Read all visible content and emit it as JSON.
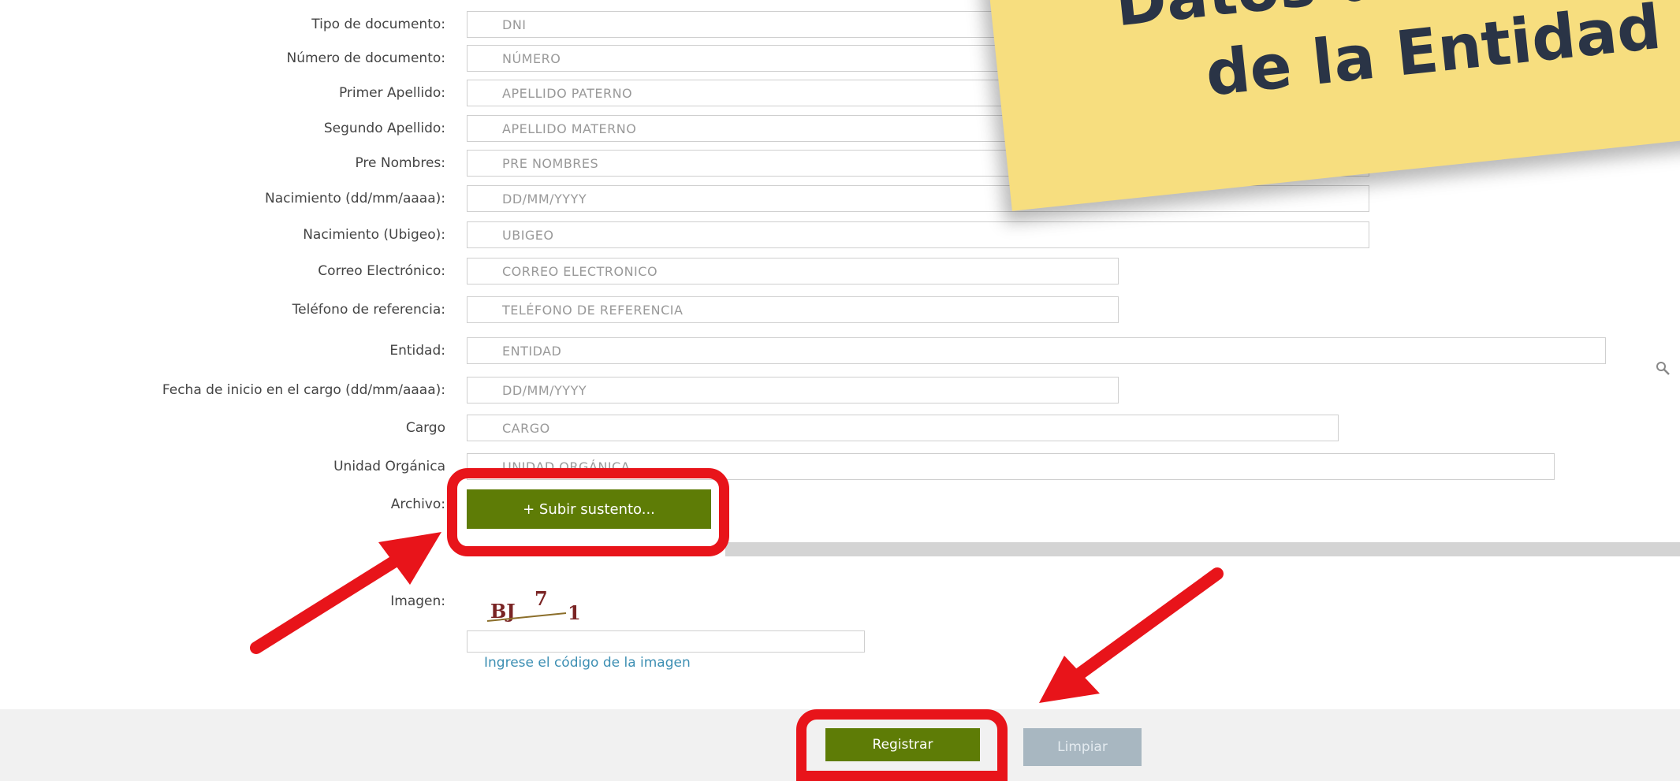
{
  "form": {
    "fields": [
      {
        "label": "Tipo de documento:",
        "value": "DNI"
      },
      {
        "label": "Número de documento:",
        "value": "NÚMERO"
      },
      {
        "label": "Primer Apellido:",
        "value": "APELLIDO PATERNO"
      },
      {
        "label": "Segundo Apellido:",
        "value": "APELLIDO MATERNO"
      },
      {
        "label": "Pre Nombres:",
        "value": "PRE NOMBRES"
      },
      {
        "label": "Nacimiento (dd/mm/aaaa):",
        "value": "DD/MM/YYYY"
      },
      {
        "label": "Nacimiento (Ubigeo):",
        "value": "UBIGEO"
      },
      {
        "label": "Correo Electrónico:",
        "value": "CORREO ELECTRONICO"
      },
      {
        "label": "Teléfono de referencia:",
        "value": "TELÉFONO DE REFERENCIA"
      },
      {
        "label": "Entidad:",
        "value": "ENTIDAD"
      },
      {
        "label": "Fecha de inicio en el cargo (dd/mm/aaaa):",
        "value": "DD/MM/YYYY"
      },
      {
        "label": "Cargo",
        "value": "CARGO"
      },
      {
        "label": "Unidad Orgánica",
        "value": "UNIDAD ORGÁNICA"
      }
    ],
    "archivo_label": "Archivo:",
    "upload_button": "+ Subir sustento...",
    "imagen_label": "Imagen:",
    "captcha_text": "BJ 7 1",
    "captcha_hint": "Ingrese el código de la imagen",
    "captcha_value": ""
  },
  "actions": {
    "registrar": "Registrar",
    "limpiar": "Limpiar"
  },
  "annotation": {
    "line1": "Datos del Titular",
    "line2": "de la Entidad",
    "highlight_color": "#e8141a",
    "note_color": "#f7de7f"
  },
  "colors": {
    "primary_button": "#5e7c06",
    "disabled_button": "#a8b7c1",
    "link": "#3d8fb3"
  }
}
